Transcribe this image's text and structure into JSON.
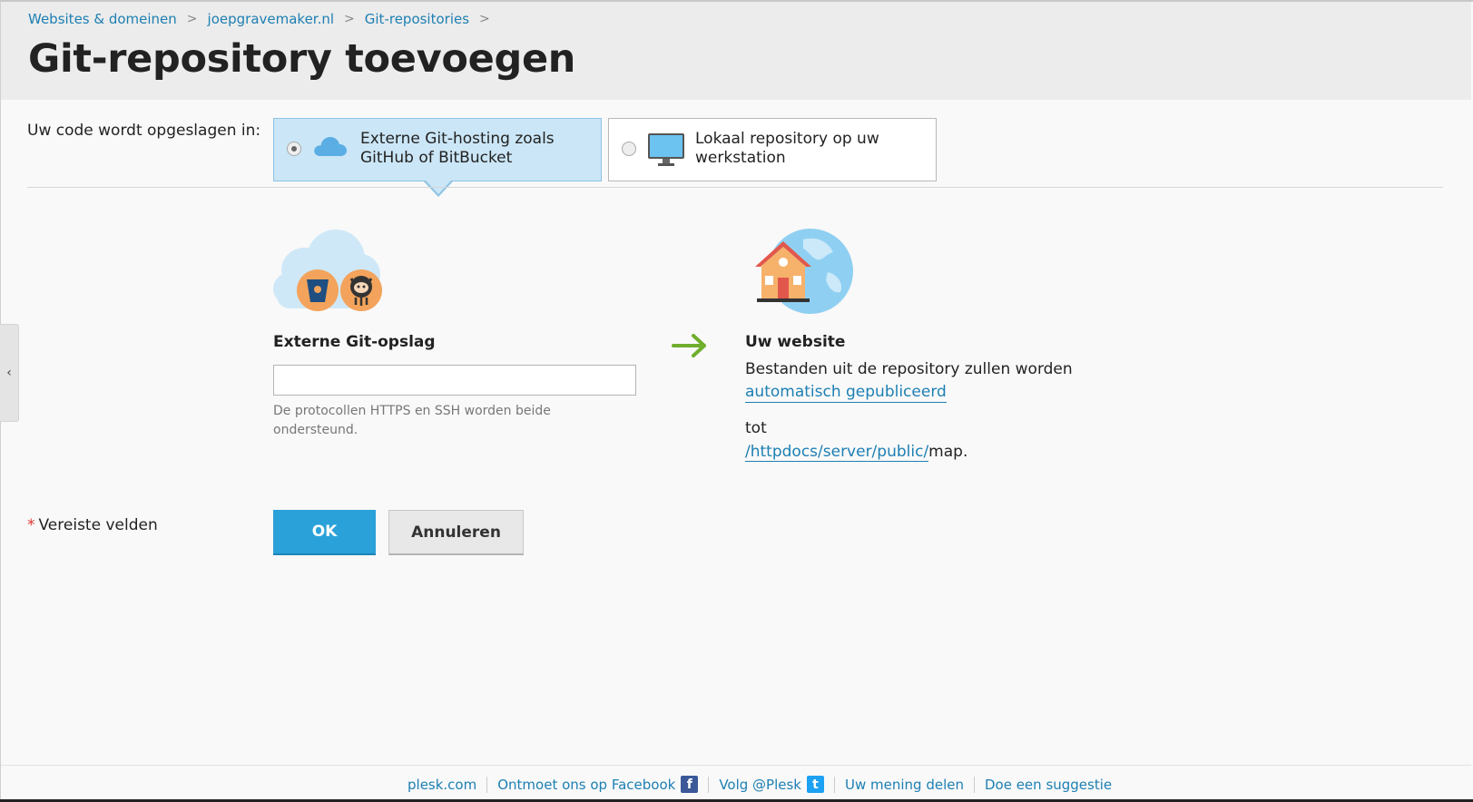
{
  "breadcrumb": {
    "items": [
      "Websites & domeinen",
      "joepgravemaker.nl",
      "Git-repositories"
    ],
    "separator": ">"
  },
  "page": {
    "title": "Git-repository toevoegen"
  },
  "sidebar": {
    "collapse_icon": "‹"
  },
  "storage": {
    "label": "Uw code wordt opgeslagen in:",
    "options": [
      {
        "label": "Externe Git-hosting zoals GitHub of BitBucket",
        "icon": "cloud-icon",
        "selected": true
      },
      {
        "label": "Lokaal repository op uw werkstation",
        "icon": "monitor-icon",
        "selected": false
      }
    ]
  },
  "external": {
    "title": "Externe Git-opslag",
    "input_value": "",
    "input_placeholder": "",
    "hint": "De protocollen HTTPS en SSH worden beide ondersteund."
  },
  "website": {
    "title": "Uw website",
    "description": "Bestanden uit de repository zullen worden",
    "link": "automatisch gepubliceerd",
    "to": "tot",
    "path": "/httpdocs/server/public/",
    "suffix": "map."
  },
  "form": {
    "required_star": "*",
    "required_label": "Vereiste velden",
    "ok_label": "OK",
    "cancel_label": "Annuleren"
  },
  "footer": {
    "links": [
      "plesk.com",
      "Ontmoet ons op Facebook",
      "Volg @Plesk",
      "Uw mening delen",
      "Doe een suggestie"
    ],
    "facebook_glyph": "f",
    "twitter_glyph": "t"
  },
  "colors": {
    "accent": "#2aa1d8",
    "link": "#1d7fb3",
    "selected_option": "#cbe6f6",
    "arrow": "#6fae2e"
  }
}
